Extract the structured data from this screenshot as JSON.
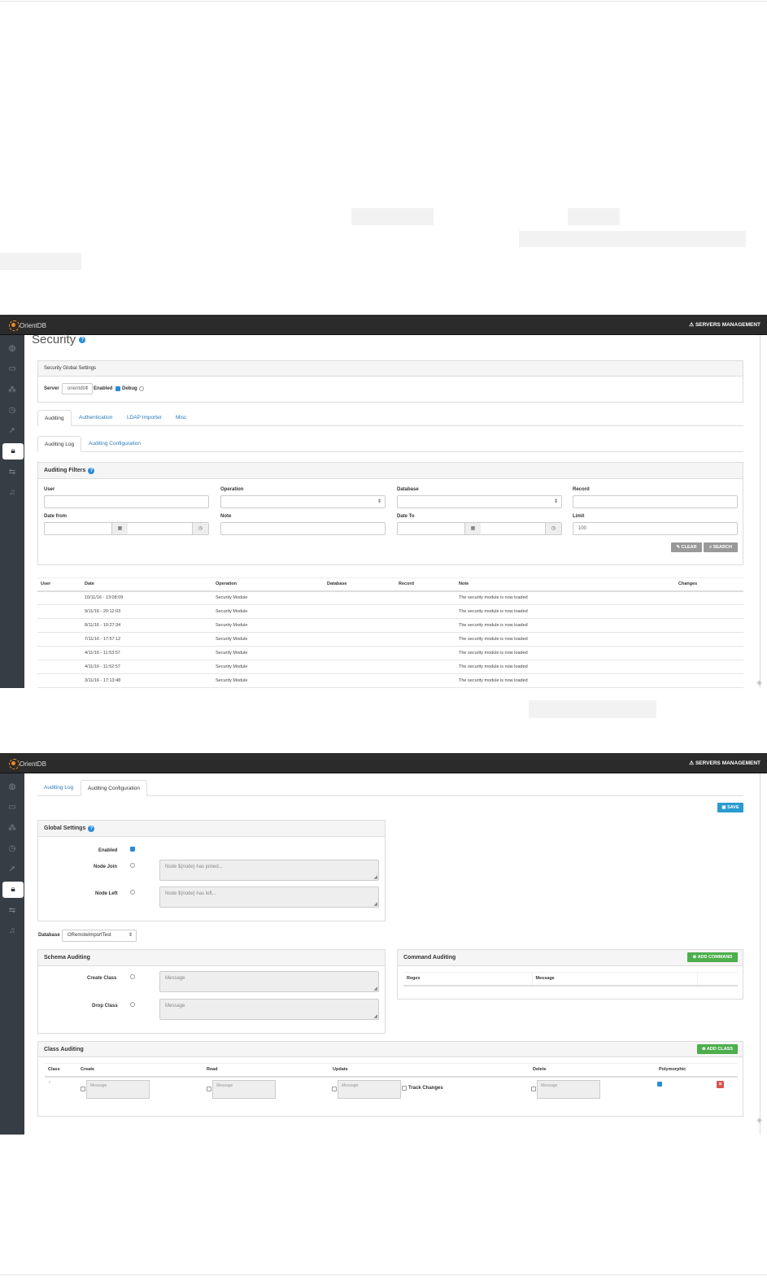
{
  "screen1": {
    "brand": "OrientDB",
    "servers_management": "SERVERS MANAGEMENT",
    "page_title": "Security",
    "global_settings_title": "Security Global Settings",
    "server_label": "Server",
    "server_value": "orientdb",
    "enabled_label": "Enabled",
    "debug_label": "Debug",
    "tabs": [
      "Auditing",
      "Authentication",
      "LDAP Importer",
      "Misc"
    ],
    "subtabs": [
      "Auditing Log",
      "Auditing Configuration"
    ],
    "filters_title": "Auditing Filters",
    "filter_labels": {
      "user": "User",
      "operation": "Operation",
      "database": "Database",
      "record": "Record",
      "date_from": "Date from",
      "note": "Note",
      "date_to": "Date To",
      "limit": "Limit"
    },
    "limit_value": "100",
    "clear_label": "CLEAR",
    "search_label": "SEARCH",
    "table_headers": [
      "User",
      "Date",
      "Operation",
      "Database",
      "Record",
      "Note",
      "Changes"
    ],
    "rows": [
      {
        "date": "10/11/16 - 13:08:09",
        "operation": "Security Module",
        "note": "The security module is now loaded"
      },
      {
        "date": "9/11/16 - 20:12:03",
        "operation": "Security Module",
        "note": "The security module is now loaded"
      },
      {
        "date": "8/11/16 - 10:27:34",
        "operation": "Security Module",
        "note": "The security module is now loaded"
      },
      {
        "date": "7/11/16 - 17:57:12",
        "operation": "Security Module",
        "note": "The security module is now loaded"
      },
      {
        "date": "4/11/16 - 11:53:57",
        "operation": "Security Module",
        "note": "The security module is now loaded"
      },
      {
        "date": "4/11/16 - 11:52:57",
        "operation": "Security Module",
        "note": "The security module is now loaded"
      },
      {
        "date": "3/11/16 - 17:13:48",
        "operation": "Security Module",
        "note": "The security module is now loaded"
      }
    ]
  },
  "screen2": {
    "brand": "OrientDB",
    "servers_management": "SERVERS MANAGEMENT",
    "subtabs": [
      "Auditing Log",
      "Auditing Configuration"
    ],
    "save_label": "SAVE",
    "global_settings_title": "Global Settings",
    "enabled_label": "Enabled",
    "node_join_label": "Node Join",
    "node_join_placeholder": "Node ${node} has joined...",
    "node_left_label": "Node Left",
    "node_left_placeholder": "Node ${node} has left...",
    "database_label": "Database",
    "database_value": "ORemoteImportTest",
    "schema_auditing_title": "Schema Auditing",
    "create_class_label": "Create Class",
    "drop_class_label": "Drop Class",
    "message_placeholder": "Message",
    "command_auditing_title": "Command Auditing",
    "add_command_label": "ADD COMMAND",
    "command_headers": [
      "Regex",
      "Message"
    ],
    "class_auditing_title": "Class Auditing",
    "add_class_label": "ADD CLASS",
    "class_headers": [
      "Class",
      "Create",
      "Read",
      "Update",
      "Delete",
      "Polymorphic"
    ],
    "class_row_name": "-",
    "track_changes_label": "Track Changes"
  }
}
